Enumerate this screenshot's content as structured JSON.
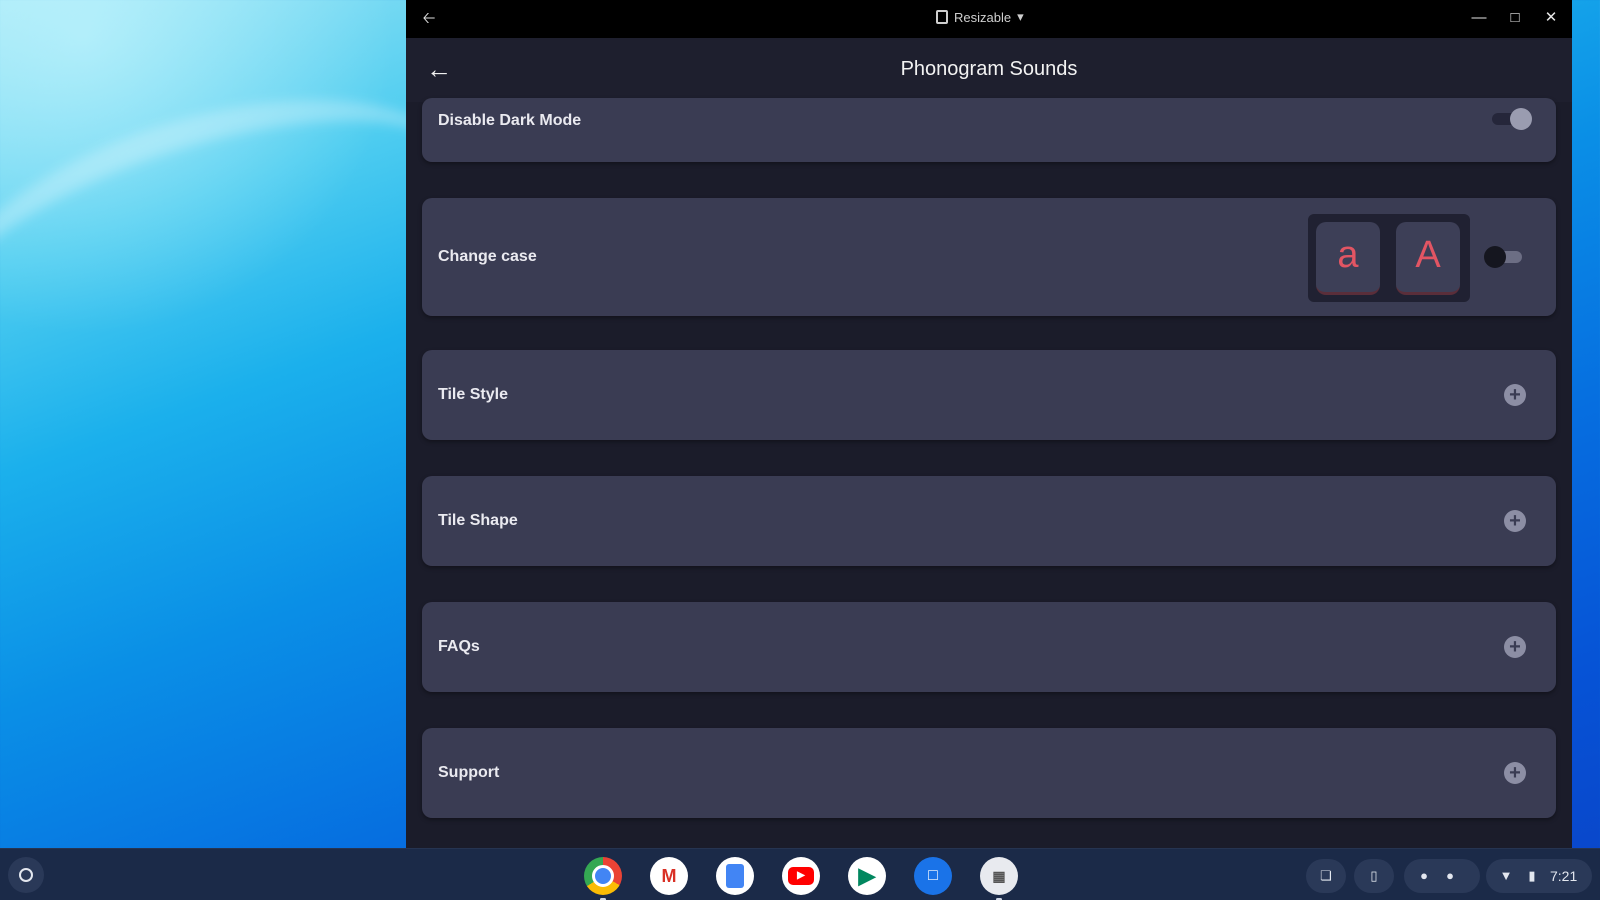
{
  "titlebar": {
    "back_icon": "arrow-left-icon",
    "mode_label": "Resizable",
    "mode_icon": "resize-icon",
    "minimize_icon": "minimize-icon",
    "maximize_icon": "maximize-icon",
    "close_icon": "close-icon"
  },
  "appbar": {
    "title": "Phonogram Sounds",
    "back_icon": "arrow-left-icon"
  },
  "settings": {
    "disable_dark_mode": {
      "label": "Disable Dark Mode",
      "toggle_on": false
    },
    "change_case": {
      "label": "Change case",
      "lower_key": "a",
      "upper_key": "A",
      "toggle_on": false
    },
    "tile_style": {
      "label": "Tile Style",
      "icon": "plus-icon"
    },
    "tile_shape": {
      "label": "Tile Shape",
      "icon": "plus-icon"
    },
    "faqs": {
      "label": "FAQs",
      "icon": "plus-icon"
    },
    "support": {
      "label": "Support",
      "icon": "plus-icon"
    }
  },
  "colors": {
    "accent_case_letter": "#e25563",
    "card_bg": "#3a3c53",
    "window_bg": "#1b1c2a"
  },
  "shelf": {
    "apps": [
      "chrome-icon",
      "gmail-icon",
      "docs-icon",
      "youtube-icon",
      "play-store-icon",
      "messages-icon",
      "phonogram-app-icon"
    ],
    "tray": {
      "time": "7:21"
    }
  }
}
